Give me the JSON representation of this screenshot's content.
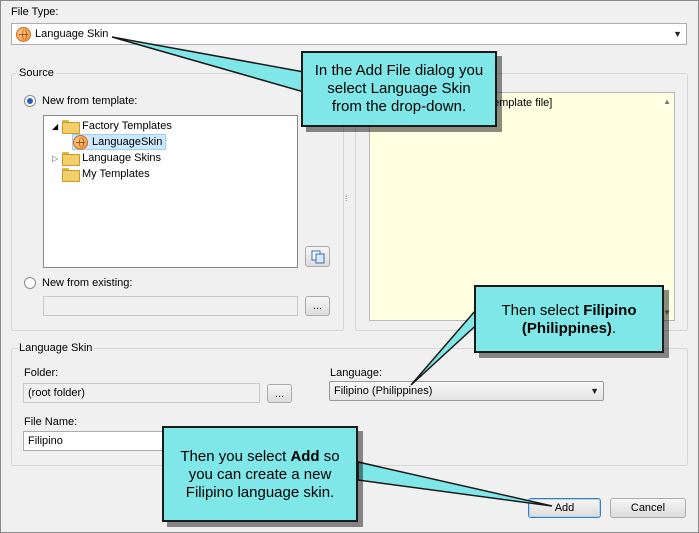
{
  "file_type": {
    "label": "File Type:",
    "selected": "Language Skin"
  },
  "source": {
    "title": "Source",
    "new_from_template_label": "New from template:",
    "tree": [
      {
        "label": "Factory Templates",
        "icon": "folder-open-icon",
        "expanded": true
      },
      {
        "label": "LanguageSkin",
        "icon": "globe-icon",
        "selected": true
      },
      {
        "label": "Language Skins",
        "icon": "folder-icon",
        "expanded": false
      },
      {
        "label": "My Templates",
        "icon": "folder-icon"
      }
    ],
    "new_from_existing_label": "New from existing:",
    "browse_label": "...",
    "preview_text": "emplate file]"
  },
  "language_skin": {
    "title": "Language Skin",
    "folder_label": "Folder:",
    "folder_value": "(root folder)",
    "browse_label": "...",
    "language_label": "Language:",
    "language_value": "Filipino (Philippines)",
    "file_name_label": "File Name:",
    "file_name_value": "Filipino"
  },
  "buttons": {
    "add": "Add",
    "cancel": "Cancel"
  },
  "callouts": {
    "one": "In the Add File dialog you select Language Skin from the drop-down.",
    "two_prefix": "Then select ",
    "two_bold": "Filipino (Philippines)",
    "two_suffix": ".",
    "three_prefix": "Then you select ",
    "three_bold": "Add",
    "three_suffix": " so you can create a new Filipino language skin."
  },
  "colors": {
    "callout_fill": "#7fe7e7",
    "preview_fill": "#ffffe1",
    "radio_selected": "#2c5fb8"
  }
}
